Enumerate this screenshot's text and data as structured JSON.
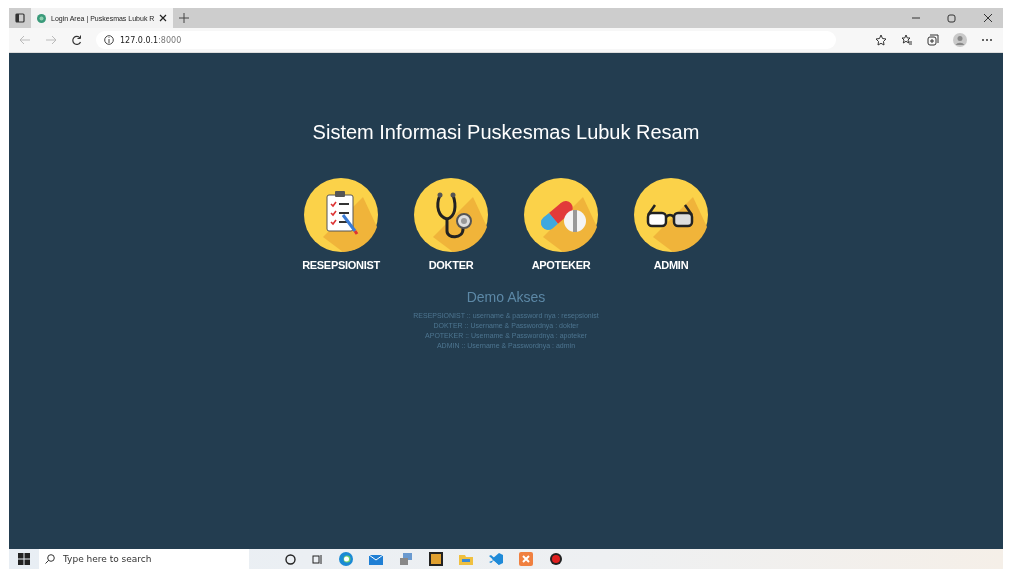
{
  "browser": {
    "tab": {
      "title": "Login Area | Puskesmas Lubuk R",
      "selected": true
    },
    "address": {
      "host": "127.0.0.1",
      "port": ":8000"
    }
  },
  "page": {
    "title": "Sistem Informasi Puskesmas Lubuk Resam",
    "roles": [
      {
        "label": "RESEPSIONIST",
        "kind": "clipboard"
      },
      {
        "label": "DOKTER",
        "kind": "stethoscope"
      },
      {
        "label": "APOTEKER",
        "kind": "pills"
      },
      {
        "label": "ADMIN",
        "kind": "glasses"
      }
    ],
    "demo": {
      "title": "Demo Akses",
      "lines": [
        "RESEPSIONIST :: username & password nya : resepsionist",
        "DOKTER :: Username & Passwordnya : dokter",
        "APOTEKER :: Username & Passwordnya : apoteker",
        "ADMIN :: Username & Passwordnya : admin"
      ]
    }
  },
  "taskbar": {
    "search": {
      "placeholder": "Type here to search"
    }
  }
}
